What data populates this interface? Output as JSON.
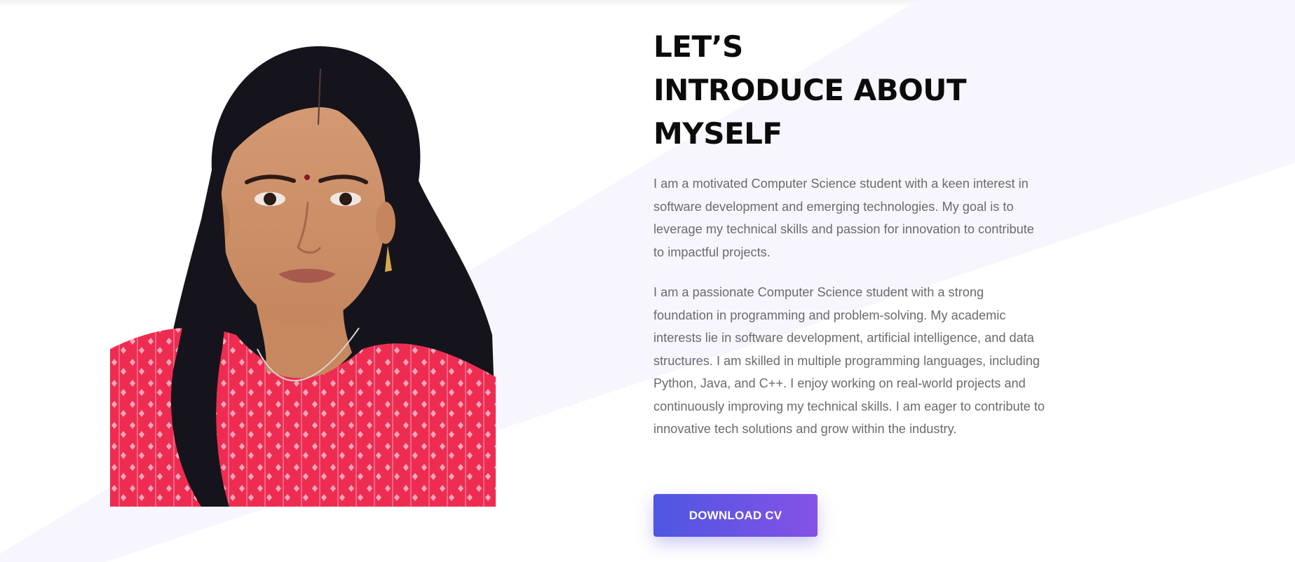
{
  "about": {
    "title_lines": [
      "LET’S",
      "INTRODUCE ABOUT",
      "MYSELF"
    ],
    "paragraphs": [
      "I am a motivated Computer Science student with a keen interest in software development and emerging technologies. My goal is to leverage my technical skills and passion for innovation to contribute to impactful projects.",
      "I am a passionate Computer Science student with a strong foundation in programming and problem-solving. My academic interests lie in software development, artificial intelligence, and data structures. I am skilled in multiple programming languages, including Python, Java, and C++. I enjoy working on real-world projects and continuously improving my technical skills. I am eager to contribute to innovative tech solutions and grow within the industry."
    ],
    "download_cv_label": "DOWNLOAD CV"
  },
  "colors": {
    "heading": "#0b0b0b",
    "body_text": "#6b6b6b",
    "background_tint": "#f7f6ff",
    "button_gradient_start": "#4e56e2",
    "button_gradient_end": "#8552e6",
    "button_text": "#ffffff"
  },
  "icons": {
    "portrait": "profile-photo"
  }
}
